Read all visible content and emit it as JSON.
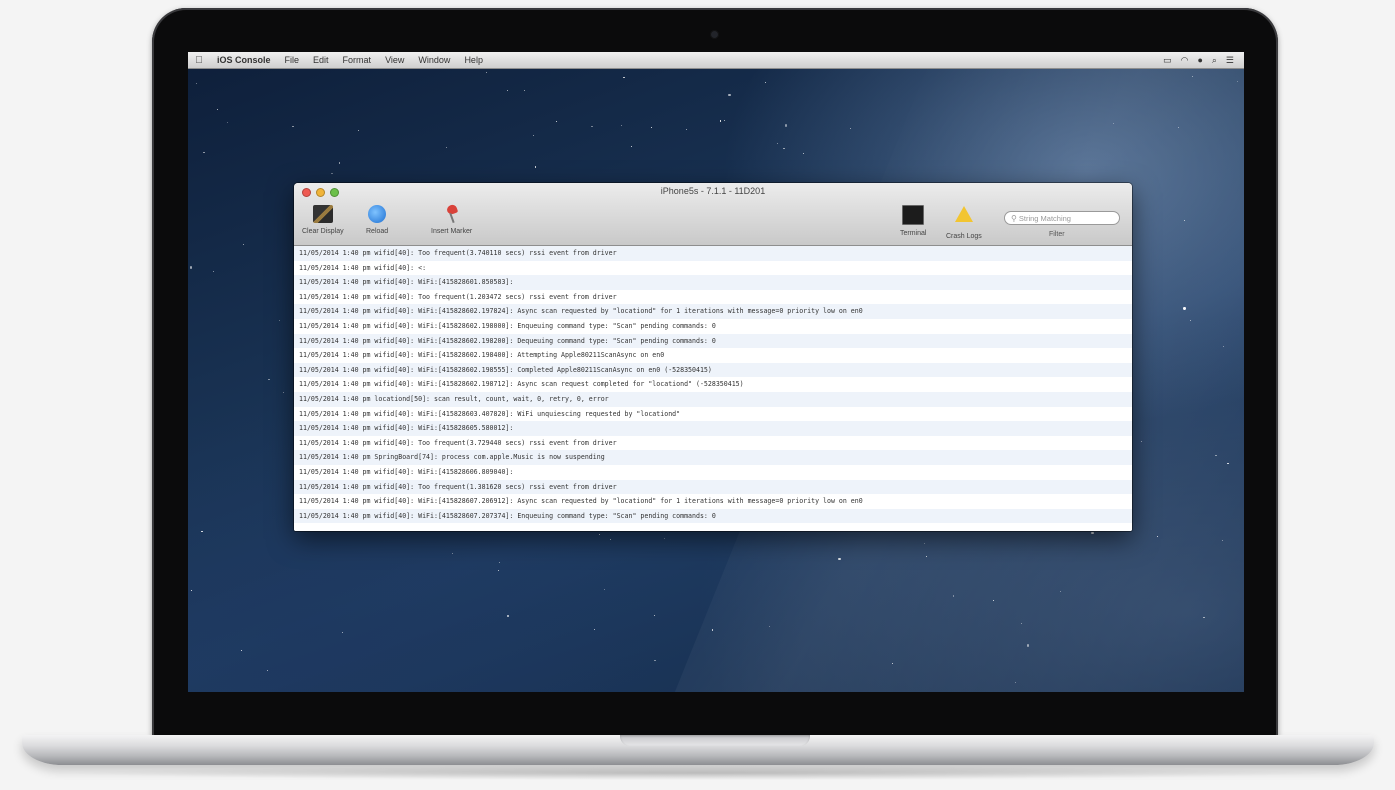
{
  "menubar": {
    "apple": "",
    "items": [
      "iOS Console",
      "File",
      "Edit",
      "Format",
      "View",
      "Window",
      "Help"
    ]
  },
  "window": {
    "title": "iPhone5s - 7.1.1 - 11D201",
    "toolbar": {
      "clear_display": "Clear Display",
      "reload": "Reload",
      "insert_marker": "Insert Marker",
      "terminal": "Terminal",
      "crash_logs": "Crash Logs",
      "filter": "Filter",
      "search_placeholder": "String Matching"
    },
    "log_lines": [
      "11/05/2014 1:40 pm wifid[40]: Too frequent(3.740110 secs) rssi event from driver",
      "11/05/2014 1:40 pm wifid[40]: <:",
      "11/05/2014 1:40 pm wifid[40]: WiFi:[415828601.850583]:",
      "11/05/2014 1:40 pm wifid[40]: Too frequent(1.203472 secs) rssi event from driver",
      "11/05/2014 1:40 pm wifid[40]: WiFi:[415828602.197824]: Async scan requested by \"locationd\" for 1 iterations with message=0 priority low on en0",
      "11/05/2014 1:40 pm wifid[40]: WiFi:[415828602.198000]: Enqueuing command type: \"Scan\" pending commands: 0",
      "11/05/2014 1:40 pm wifid[40]: WiFi:[415828602.198200]: Dequeuing command type: \"Scan\" pending commands: 0",
      "11/05/2014 1:40 pm wifid[40]: WiFi:[415828602.198400]: Attempting Apple80211ScanAsync on en0",
      "11/05/2014 1:40 pm wifid[40]: WiFi:[415828602.198555]: Completed Apple80211ScanAsync on en0 (-528350415)",
      "11/05/2014 1:40 pm wifid[40]: WiFi:[415828602.198712]: Async scan request completed for \"locationd\" (-528350415)",
      "11/05/2014 1:40 pm locationd[50]: scan result, count, wait, 0, retry, 0, error",
      "11/05/2014 1:40 pm wifid[40]: WiFi:[415828603.407820]: WiFi unquiescing requested by \"locationd\"",
      "11/05/2014 1:40 pm wifid[40]: WiFi:[415828605.580012]:",
      "11/05/2014 1:40 pm wifid[40]: Too frequent(3.729440 secs) rssi event from driver",
      "11/05/2014 1:40 pm SpringBoard[74]: process com.apple.Music is now suspending",
      "11/05/2014 1:40 pm wifid[40]: WiFi:[415828606.809040]:",
      "11/05/2014 1:40 pm wifid[40]: Too frequent(1.381620 secs) rssi event from driver",
      "11/05/2014 1:40 pm wifid[40]: WiFi:[415828607.206912]: Async scan requested by \"locationd\" for 1 iterations with message=0 priority low on en0",
      "11/05/2014 1:40 pm wifid[40]: WiFi:[415828607.207374]: Enqueuing command type: \"Scan\" pending commands: 0"
    ]
  },
  "icons": {
    "clear_display": "broom-icon",
    "reload": "reload-icon",
    "insert_marker": "marker-flag-icon",
    "terminal": "terminal-icon",
    "crash_logs": "warning-icon",
    "search": "magnifier-icon"
  },
  "colors": {
    "desktop_blue": "#1b3658",
    "log_stripe": "#eef3fa",
    "close": "#ee5a52",
    "minimize": "#f0b43a",
    "zoom": "#6cc04a"
  }
}
